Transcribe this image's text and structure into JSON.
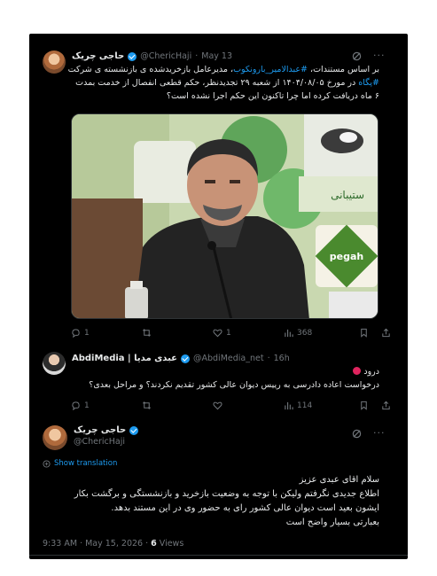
{
  "tweet1": {
    "display_name": "حاجی چریک",
    "handle": "@ChericHaji",
    "date": "May 13",
    "text_line1_before": "بر اساس مستندات، ",
    "text_line1_link": "#عبدالامیر_بارونکوب",
    "text_line1_after": "، مدیرعامل بازخریدشده ی بازنشسته ی شرکت",
    "text_line2_link": "#پگاه",
    "text_line2_after": " در مورخ ۱۴۰۴/۰۸/۰۵ از شعبه ۲۹ تجدیدنظر، حکم قطعی انفصال از خدمت بمدت",
    "text_line3": "۶ ماه دریافت کرده اما چرا تاکنون این حکم اجرا نشده است؟",
    "photo_alt": "Photo",
    "photo_sign_text": "ستیبانی",
    "photo_logo_text": "pegah",
    "stats": {
      "replies": "1",
      "reposts": "",
      "likes": "1",
      "views": "368"
    }
  },
  "tweet2": {
    "display_name": "AbdiMedia | عبدی مدیا",
    "handle": "@AbdiMedia_net",
    "age": "16h",
    "line1": "درود",
    "line2": "درخواست اعاده دادرسی به رییس دیوان عالی کشور تقدیم نکردند؟ و مراحل بعدی؟",
    "stats": {
      "replies": "1",
      "reposts": "",
      "likes": "",
      "views": "114"
    }
  },
  "tweet3": {
    "display_name": "حاجی چریک",
    "handle": "@ChericHaji",
    "show_translation": "Show translation",
    "line1": "سلام اقای عبدی عزیز",
    "line2": "اطلاع جدیدی نگرفتم ولیکن با توجه به وضعیت بازخرید و بازنشستگی و برگشت بکار",
    "line3": "ایشون بعید است دیوان عالی کشور رای به حضور وی در این مستند بدهد.",
    "line4": "بعبارتی بسیار واضح است",
    "time": "9:33 AM · May 15, 2026 · ",
    "views_count": "6",
    "views_label": " Views"
  },
  "colors": {
    "background": "#000000",
    "link": "#1d9bf0",
    "muted": "#71767b",
    "verified": "#1d9bf0",
    "red_emoji": "#e0245e"
  },
  "icons": [
    "verified-badge-icon",
    "grok-icon",
    "reply-icon",
    "repost-icon",
    "like-icon",
    "views-icon",
    "bookmark-icon",
    "share-icon",
    "translate-icon"
  ]
}
